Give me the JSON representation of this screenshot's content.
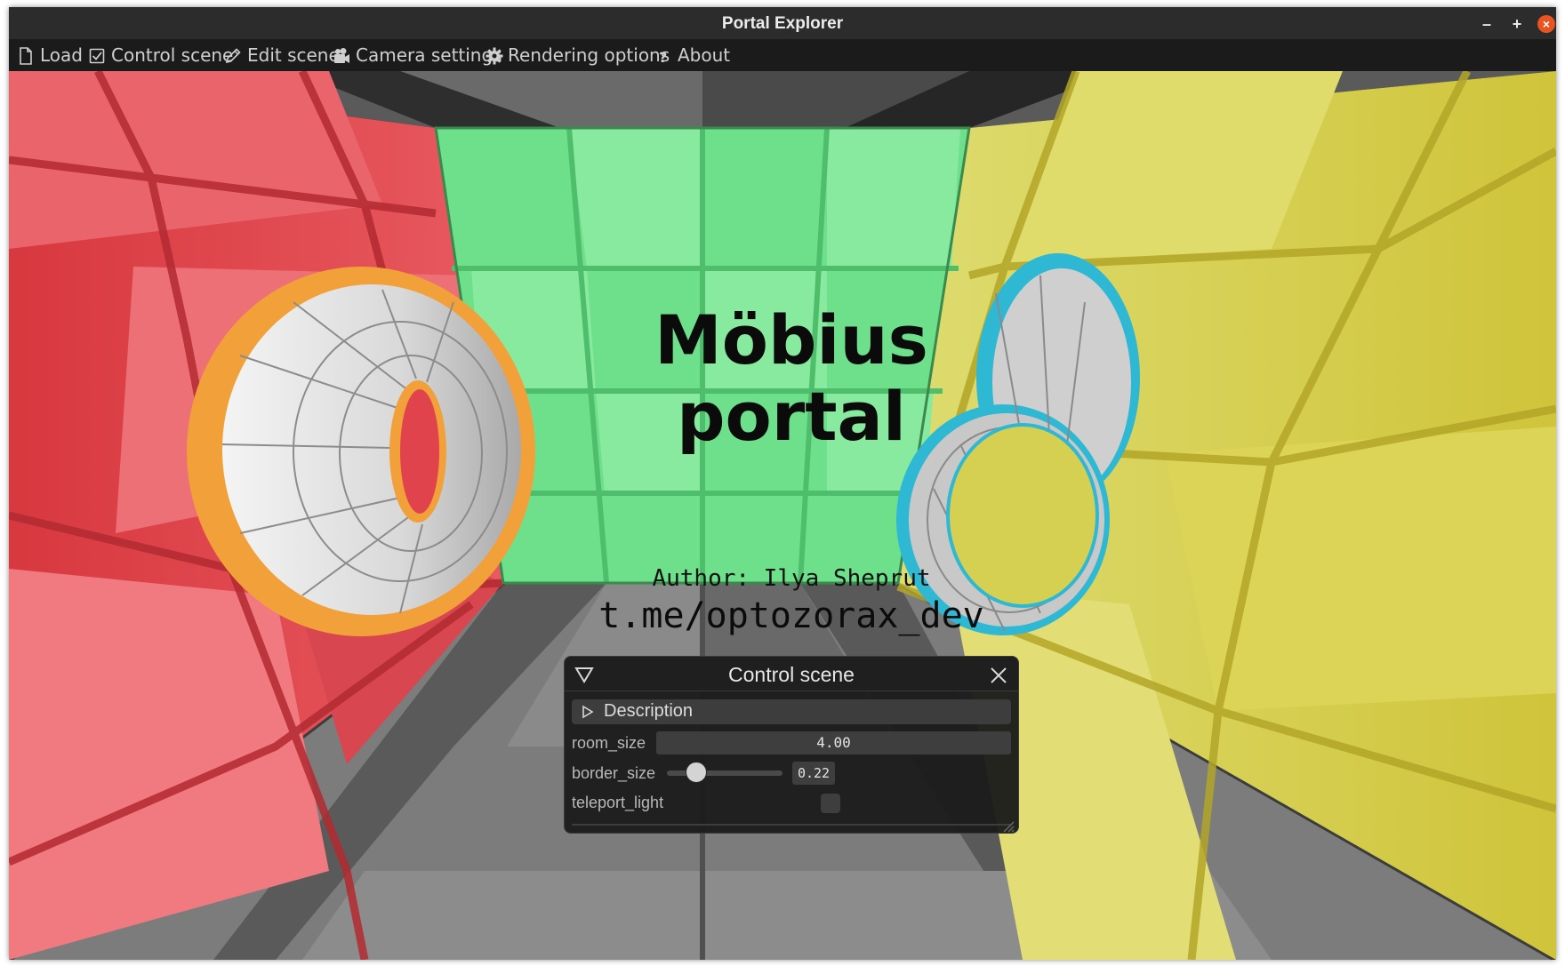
{
  "window": {
    "title": "Portal Explorer",
    "controls": {
      "minimize": "–",
      "maximize": "+",
      "close": "×"
    }
  },
  "menu": [
    {
      "label": "Load",
      "icon": "file-icon"
    },
    {
      "label": "Control scene",
      "icon": "checkbox-icon"
    },
    {
      "label": "Edit scene",
      "icon": "pencil-icon"
    },
    {
      "label": "Camera settings",
      "icon": "camera-icon"
    },
    {
      "label": "Rendering options",
      "icon": "gear-icon"
    },
    {
      "label": "About",
      "icon": "question-icon"
    }
  ],
  "scene": {
    "title_line1": "Möbius",
    "title_line2": "portal",
    "author": "Author: Ilya Sheprut",
    "link": "t.me/optozorax_dev",
    "colors": {
      "left_wall": "#e0434b",
      "back_wall": "#6ee08c",
      "right_wall": "#d9d24c",
      "floor_ceiling": "#7a7a7a",
      "portal_left_rim": "#f2a03a",
      "portal_right_rim": "#2fb8d4"
    }
  },
  "control_panel": {
    "title": "Control scene",
    "description_label": "Description",
    "params": {
      "room_size": {
        "label": "room_size",
        "value": "4.00"
      },
      "border_size": {
        "label": "border_size",
        "value": "0.22",
        "slider_fraction": 0.2
      },
      "teleport_light": {
        "label": "teleport_light",
        "checked": false
      }
    }
  }
}
